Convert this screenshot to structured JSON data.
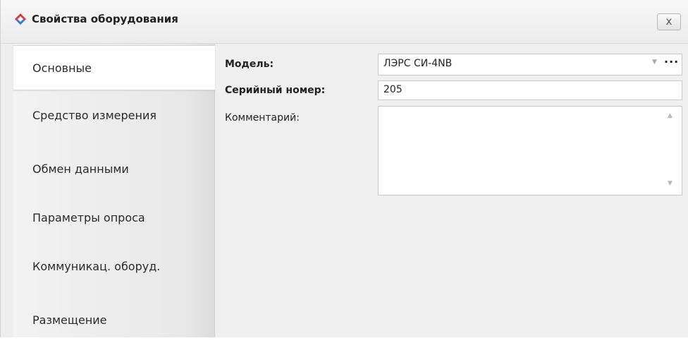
{
  "window": {
    "title": "Свойства оборудования",
    "close_label": "x"
  },
  "sidebar": {
    "items": [
      {
        "label": "Основные",
        "active": true
      },
      {
        "label": "Средство измерения",
        "active": false
      },
      {
        "label": "Обмен данными",
        "active": false
      },
      {
        "label": "Параметры опроса",
        "active": false
      },
      {
        "label": "Коммуникац. оборуд.",
        "active": false
      },
      {
        "label": "Размещение",
        "active": false
      }
    ]
  },
  "form": {
    "model_label": "Модель:",
    "model_value": "ЛЭРС СИ-4NB",
    "model_more": "···",
    "serial_label": "Серийный номер:",
    "serial_value": "205",
    "comment_label": "Комментарий:",
    "comment_value": ""
  },
  "colors": {
    "icon_red": "#e8333d",
    "icon_blue": "#2c7fd6",
    "active_bg": "#ffffff",
    "content_bg": "#efefef"
  }
}
